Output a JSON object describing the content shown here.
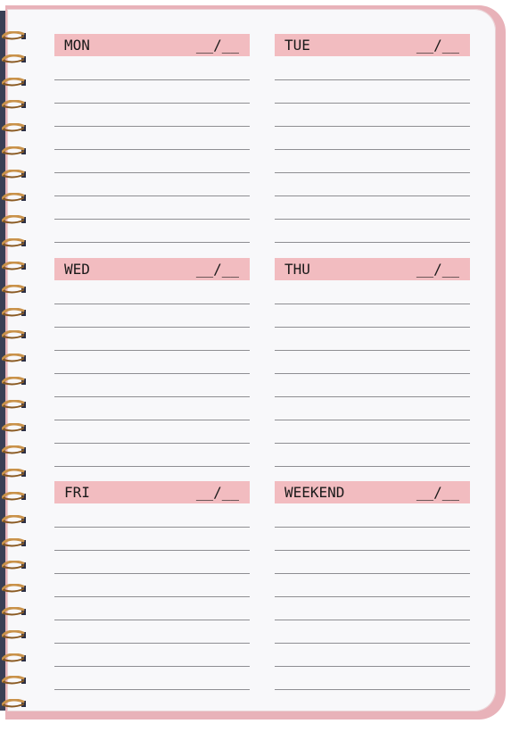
{
  "planner": {
    "sections": [
      {
        "day": "MON",
        "date": "__/__"
      },
      {
        "day": "TUE",
        "date": "__/__"
      },
      {
        "day": "WED",
        "date": "__/__"
      },
      {
        "day": "THU",
        "date": "__/__"
      },
      {
        "day": "FRI",
        "date": "__/__"
      },
      {
        "day": "WEEKEND",
        "date": "__/__"
      }
    ],
    "lines_per_section": 8
  },
  "colors": {
    "cover": "#e8b2b9",
    "header": "#f2bcc0",
    "page": "#f8f8fa",
    "coil": "#c9924a"
  }
}
